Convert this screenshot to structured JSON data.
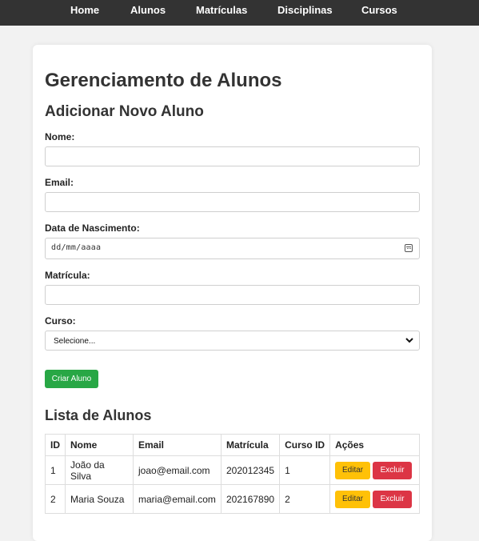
{
  "nav": {
    "items": [
      {
        "label": "Home"
      },
      {
        "label": "Alunos"
      },
      {
        "label": "Matrículas"
      },
      {
        "label": "Disciplinas"
      },
      {
        "label": "Cursos"
      }
    ]
  },
  "page": {
    "title": "Gerenciamento de Alunos"
  },
  "form": {
    "heading": "Adicionar Novo Aluno",
    "nome_label": "Nome:",
    "nome_value": "",
    "email_label": "Email:",
    "email_value": "",
    "data_label": "Data de Nascimento:",
    "data_value": "dd/mm/aaaa",
    "matricula_label": "Matrícula:",
    "matricula_value": "",
    "curso_label": "Curso:",
    "curso_selected": "Selecione...",
    "submit_label": "Criar Aluno",
    "submit_color": "#28a745"
  },
  "list": {
    "heading": "Lista de Alunos",
    "columns": [
      "ID",
      "Nome",
      "Email",
      "Matrícula",
      "Curso ID",
      "Ações"
    ],
    "rows": [
      {
        "id": "1",
        "nome": "João da Silva",
        "email": "joao@email.com",
        "matricula": "202012345",
        "curso_id": "1"
      },
      {
        "id": "2",
        "nome": "Maria Souza",
        "email": "maria@email.com",
        "matricula": "202167890",
        "curso_id": "2"
      }
    ],
    "edit_label": "Editar",
    "delete_label": "Excluir",
    "edit_color": "#ffc107",
    "delete_color": "#dc3545"
  }
}
